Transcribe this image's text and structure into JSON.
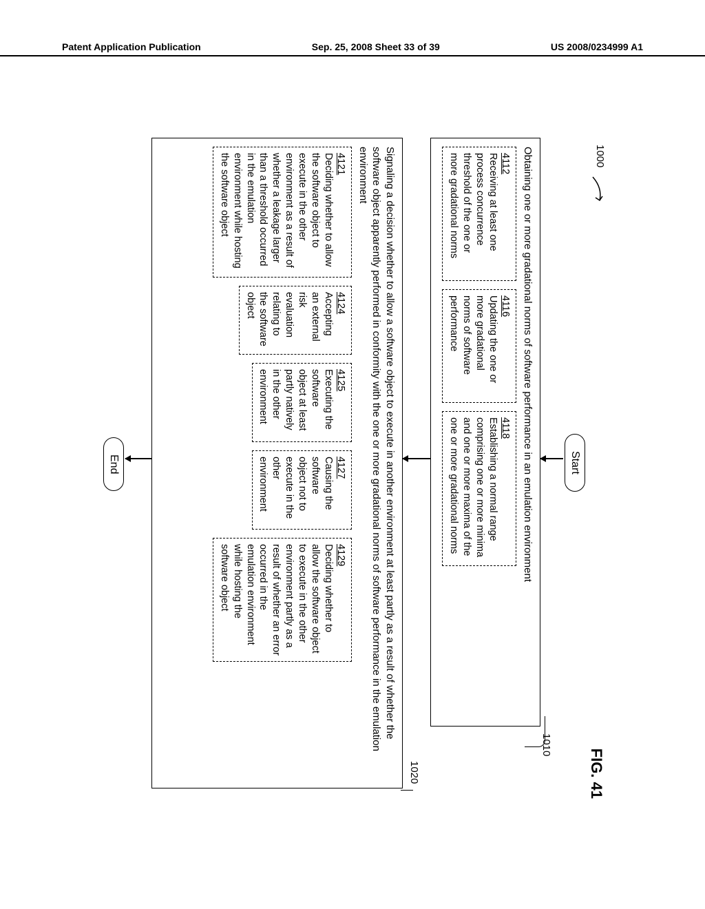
{
  "header": {
    "left": "Patent Application Publication",
    "center": "Sep. 25, 2008  Sheet 33 of 39",
    "right": "US 2008/0234999 A1"
  },
  "figure": {
    "ref_main": "1000",
    "fig_label": "FIG. 41",
    "start": "Start",
    "end": "End",
    "lead_1010": "1010",
    "lead_1020": "1020"
  },
  "box1010": {
    "title": "Obtaining one or more gradational norms of software performance in an emulation environment",
    "sub": {
      "s4112": {
        "num": "4112",
        "text": "Receiving at least one process concurrence threshold of the one or more gradational norms"
      },
      "s4116": {
        "num": "4116",
        "text": "Updating the one or more gradational norms of software performance"
      },
      "s4118": {
        "num": "4118",
        "text": "Establishing a normal range comprising one or more minima and one or more maxima of the one or more gradational norms"
      }
    }
  },
  "box1020": {
    "title": "Signaling a decision whether to allow a software object to execute in another environment at least partly as a result of whether the software object apparently performed in conformity with the one or more gradational norms of software performance in the emulation environment",
    "sub": {
      "s4121": {
        "num": "4121",
        "text": "Deciding whether to allow the software object to execute in the other environment as a result of whether a leakage larger than a threshold occurred in the emulation environment while hosting the software object"
      },
      "s4124": {
        "num": "4124",
        "text": "Accepting an external risk evaluation relating to the software object"
      },
      "s4125": {
        "num": "4125",
        "text": "Executing the software object at least partly natively in the other environment"
      },
      "s4127": {
        "num": "4127",
        "text": "Causing the software object not to execute in the other environment"
      },
      "s4129": {
        "num": "4129",
        "text": "Deciding whether to allow the software object to execute in the other environment partly as a result of whether an error occurred in the emulation environment while hosting the software object"
      }
    }
  }
}
